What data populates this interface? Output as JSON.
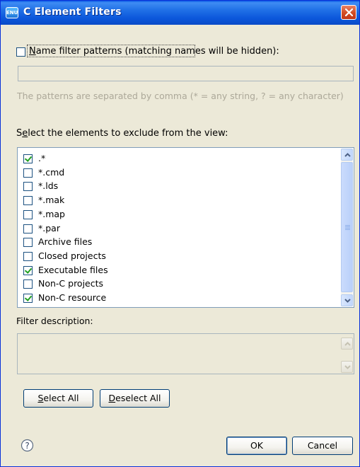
{
  "window": {
    "title": "C Element Filters",
    "app_icon_text": "ENU"
  },
  "name_filter": {
    "checked": false,
    "label_mnemonic": "N",
    "label_rest": "ame filter patterns (matching names will be hidden):",
    "value": "",
    "hint": "The patterns are separated by comma (* = any string, ? = any character)"
  },
  "select_elements": {
    "label_prefix": "S",
    "label_mnemonic": "e",
    "label_rest": "lect the elements to exclude from the view:",
    "items": [
      {
        "label": ".*",
        "checked": true
      },
      {
        "label": "*.cmd",
        "checked": false
      },
      {
        "label": "*.lds",
        "checked": false
      },
      {
        "label": "*.mak",
        "checked": false
      },
      {
        "label": "*.map",
        "checked": false
      },
      {
        "label": "*.par",
        "checked": false
      },
      {
        "label": "Archive files",
        "checked": false
      },
      {
        "label": "Closed projects",
        "checked": false
      },
      {
        "label": "Executable files",
        "checked": true
      },
      {
        "label": "Non-C projects",
        "checked": false
      },
      {
        "label": "Non-C resource",
        "checked": true
      }
    ]
  },
  "filter_description": {
    "label": "Filter description:",
    "value": ""
  },
  "buttons": {
    "select_all_mnemonic": "S",
    "select_all_rest": "elect All",
    "deselect_all_mnemonic": "D",
    "deselect_all_rest": "eselect All",
    "ok": "OK",
    "cancel": "Cancel"
  },
  "icons": {
    "help": "help-icon",
    "close": "close-icon",
    "scroll_up": "scroll-up-arrow-icon",
    "scroll_down": "scroll-down-arrow-icon"
  },
  "colors": {
    "titlebar": "#0a58e5",
    "dialog_bg": "#ece9d8",
    "close": "#d24b22",
    "check": "#21a121"
  }
}
